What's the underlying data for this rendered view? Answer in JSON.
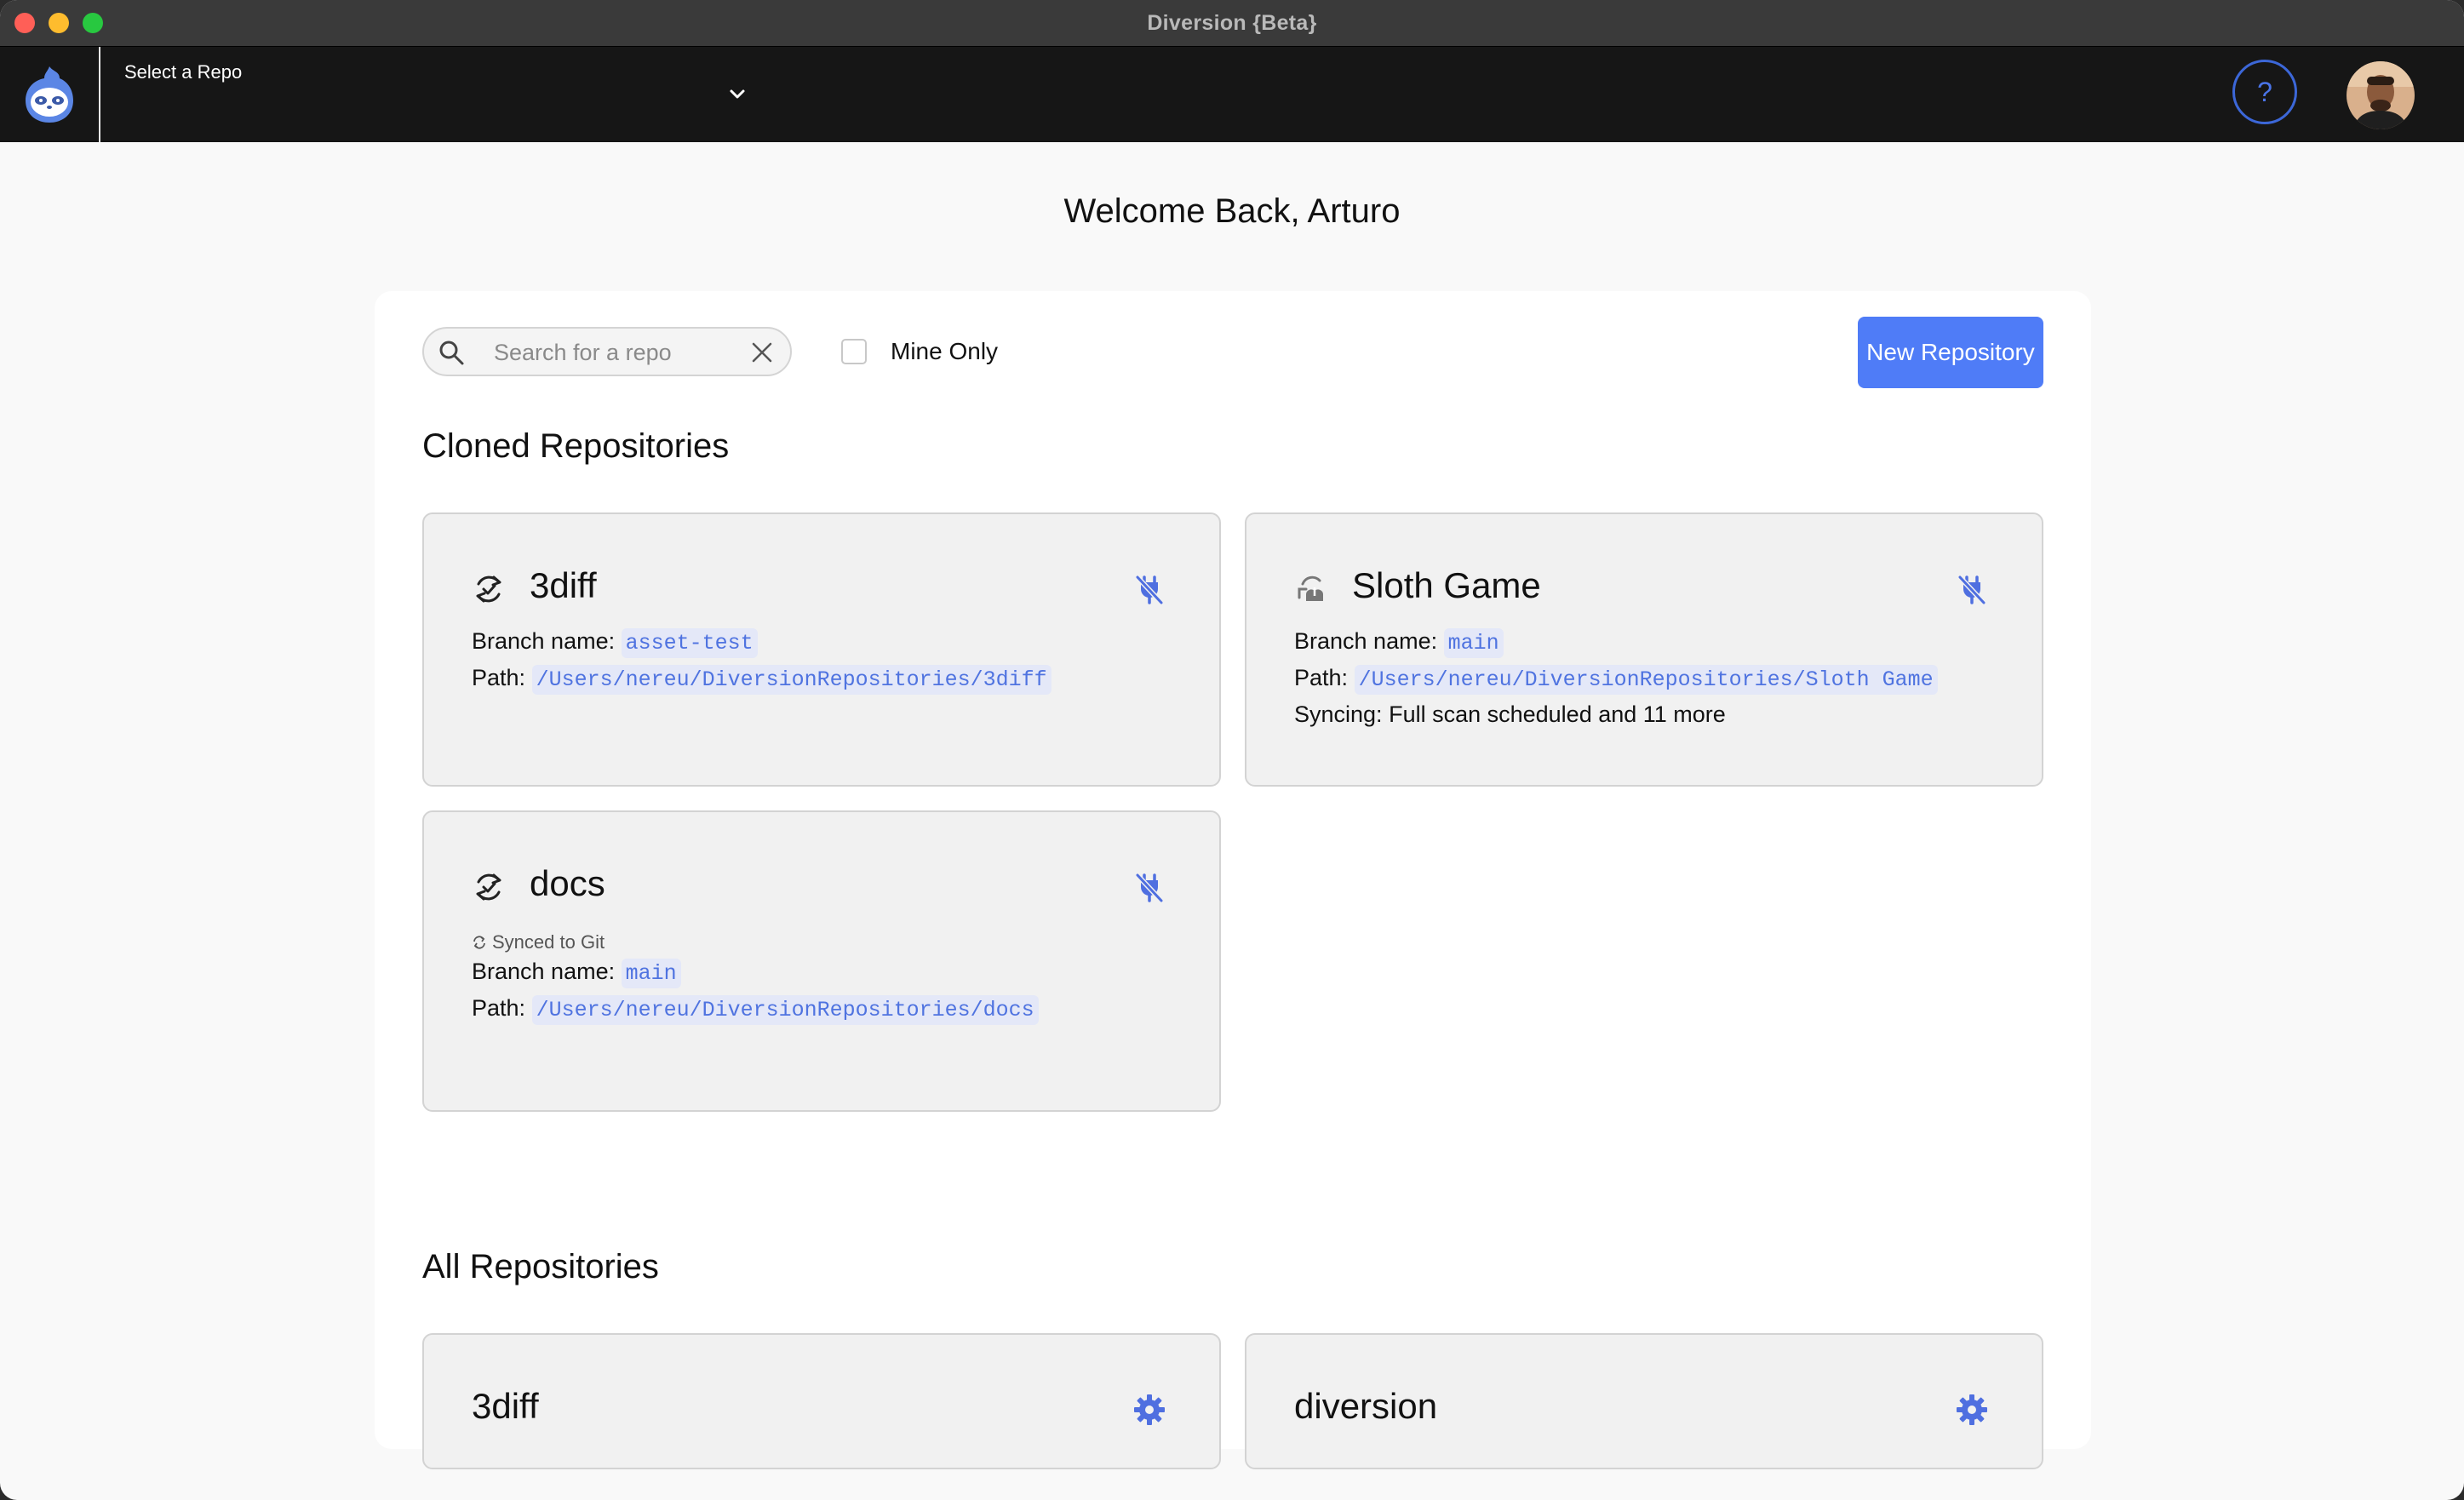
{
  "window": {
    "title": "Diversion {Beta}"
  },
  "header": {
    "repo_selector_label": "Select a Repo",
    "help_label": "?"
  },
  "welcome": "Welcome Back, Arturo",
  "toolbar": {
    "search_placeholder": "Search for a repo",
    "mine_only_label": "Mine Only",
    "mine_only_checked": false,
    "new_repo_label": "New Repository"
  },
  "cloned": {
    "title": "Cloned Repositories",
    "branch_label": "Branch name:",
    "path_label": "Path:",
    "syncing_label": "Syncing:",
    "repos": [
      {
        "name": "3diff",
        "icon": "sync-circle-icon",
        "branch": "asset-test",
        "path": "/Users/nereu/DiversionRepositories/3diff"
      },
      {
        "name": "Sloth Game",
        "icon": "cloud-sync-icon",
        "branch": "main",
        "path": "/Users/nereu/DiversionRepositories/Sloth Game",
        "syncing": "Full scan scheduled and 11 more"
      },
      {
        "name": "docs",
        "icon": "sync-circle-icon",
        "status": "Synced to Git",
        "branch": "main",
        "path": "/Users/nereu/DiversionRepositories/docs"
      }
    ]
  },
  "all": {
    "title": "All Repositories",
    "repos": [
      {
        "name": "3diff"
      },
      {
        "name": "diversion"
      }
    ]
  },
  "colors": {
    "accent": "#4f7cf7",
    "appbar": "#161616",
    "code_text": "#4f73e0",
    "code_bg": "#e4e8f8"
  }
}
